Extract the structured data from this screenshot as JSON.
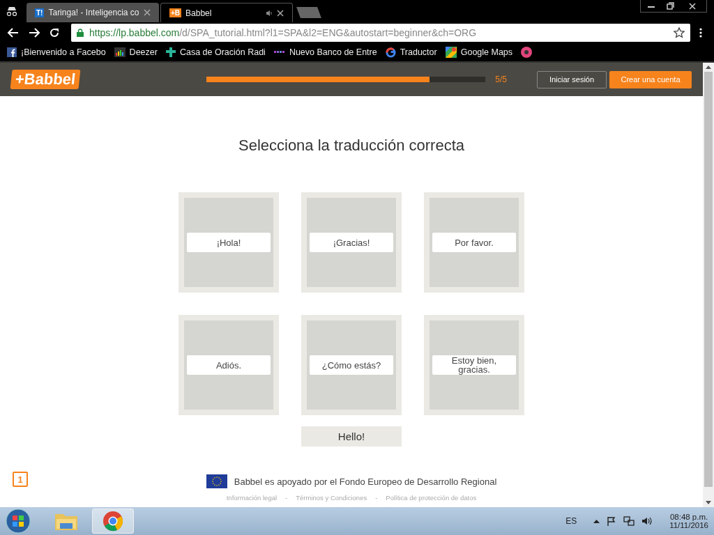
{
  "browser": {
    "tabs": [
      {
        "title": "Taringa! - Inteligencia co",
        "favicon": "T!",
        "selected": false,
        "audio": false
      },
      {
        "title": "Babbel",
        "favicon": "+B",
        "selected": true,
        "audio": true
      }
    ],
    "url": {
      "host": "https://lp.babbel.com",
      "path": "/d/SPA_tutorial.html?l1=SPA&l2=ENG&autostart=beginner&ch=ORG"
    },
    "bookmarks": [
      {
        "label": "¡Bienvenido a Facebo",
        "kind": "facebook"
      },
      {
        "label": "Deezer",
        "kind": "deezer"
      },
      {
        "label": "Casa de Oración Radi",
        "kind": "cross"
      },
      {
        "label": "Nuevo Banco de Entre",
        "kind": "dots"
      },
      {
        "label": "Traductor",
        "kind": "google"
      },
      {
        "label": "Google Maps",
        "kind": "maps"
      },
      {
        "kind": "circle"
      }
    ]
  },
  "header": {
    "logo": "+Babbel",
    "progress": {
      "level": 0.8,
      "reading": "5/5"
    },
    "login": "Iniciar sesión",
    "signup": "Crear una cuenta"
  },
  "lesson": {
    "title": "Selecciona la traducción correcta",
    "cards": [
      {
        "label": "¡Hola!"
      },
      {
        "label": "¡Gracias!"
      },
      {
        "label": "Por favor."
      },
      {
        "label": "Adiós."
      },
      {
        "label": "¿Cómo estás?"
      },
      {
        "label": "Estoy bien, gracias."
      }
    ],
    "prompt": "Hello!"
  },
  "step_badge": "1",
  "footer": {
    "note": "Babbel es apoyado por el Fondo Europeo de Desarrollo Regional",
    "links": [
      "Información legal",
      "Términos y Condiciones",
      "Política de protección de datos"
    ],
    "separators": [
      "-",
      "-"
    ]
  },
  "taskbar": {
    "language": "ES",
    "time": "08:48 p.m.",
    "date": "11/11/2016"
  }
}
